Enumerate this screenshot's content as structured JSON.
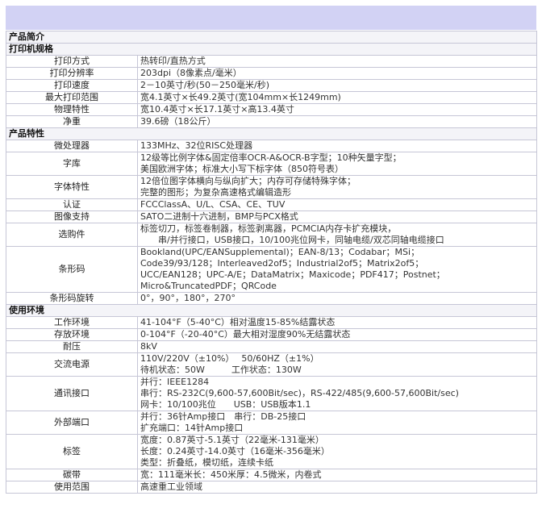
{
  "sections": [
    {
      "title": "产品简介",
      "rows": []
    },
    {
      "title": "打印机规格",
      "rows": [
        {
          "label": "打印方式",
          "lines": [
            "热转印/直热方式"
          ]
        },
        {
          "label": "打印分辨率",
          "lines": [
            "203dpi（8像素点/毫米）"
          ]
        },
        {
          "label": "打印速度",
          "lines": [
            "2－10英寸/秒(50－250毫米/秒)"
          ]
        },
        {
          "label": "最大打印范围",
          "lines": [
            "宽4.1英寸×长49.2英寸(宽104mm×长1249mm)"
          ]
        },
        {
          "label": "物理特性",
          "lines": [
            "宽10.4英寸×长17.1英寸×高13.4英寸"
          ]
        },
        {
          "label": "净重",
          "lines": [
            "39.6磅（18公斤）"
          ]
        }
      ]
    },
    {
      "title": "产品特性",
      "rows": [
        {
          "label": "微处理器",
          "lines": [
            "133MHz、32位RISC处理器"
          ]
        },
        {
          "label": "字库",
          "lines": [
            "12级等比例字体&固定倍率OCR-A&OCR-B字型；10种矢量字型；",
            "美国欧洲字体；标准大小写下标字体（850符号表）"
          ]
        },
        {
          "label": "字体特性",
          "lines": [
            "12倍位图字体横向与纵向扩大；内存可存储特殊字体；",
            "完整的图形；为复杂高速格式编辑造形"
          ]
        },
        {
          "label": "认证",
          "lines": [
            "FCCClassA、U/L、CSA、CE、TUV"
          ]
        },
        {
          "label": "图像支持",
          "lines": [
            "SATO二进制十六进制，BMP与PCX格式"
          ]
        },
        {
          "label": "选购件",
          "lines": [
            "标签切刀，标签卷制器，标签剥离器，PCMCIA内存卡扩充模块，",
            "　　串/并行接口，USB接口，10/100兆位网卡，同轴电缆/双芯同轴电缆接口"
          ]
        },
        {
          "label": "条形码",
          "lines": [
            "Bookland(UPC/EANSupplemental)；EAN-8/13；Codabar；MSi；",
            "Code39/93/128；Interleaved2of5；Industrial2of5；Matrix2of5；",
            "UCC/EAN128；UPC-A/E；DataMatrix；Maxicode；PDF417；Postnet；",
            "Micro&TruncatedPDF；QRCode"
          ]
        },
        {
          "label": "条形码旋转",
          "lines": [
            "0°，90°，180°，270°"
          ]
        }
      ]
    },
    {
      "title": "使用环境",
      "rows": [
        {
          "label": "工作环境",
          "lines": [
            "41-104°F（5-40°C）相对温度15-85%结露状态"
          ]
        },
        {
          "label": "存放环境",
          "lines": [
            "0-104°F（-20-40°C）最大相对湿度90%无结露状态"
          ]
        },
        {
          "label": "耐压",
          "lines": [
            "8kV"
          ]
        },
        {
          "label": "交流电源",
          "lines": [
            "110V/220V（±10%）　 50/60HZ（±1%）",
            "待机状态：50W　　　工作状态：130W"
          ]
        },
        {
          "label": "通讯接口",
          "lines": [
            "并行：IEEE1284",
            "串行：RS-232C(9,600-57,600Bit/sec)，RS-422/485(9,600-57,600Bit/sec)",
            "网卡：10/100兆位　　USB：USB版本1.1"
          ]
        },
        {
          "label": "外部端口",
          "lines": [
            "并行：36针Amp接口　串行：DB-25接口",
            "扩充端口：14针Amp接口"
          ]
        },
        {
          "label": "标签",
          "lines": [
            "宽度：0.87英寸-5.1英寸（22毫米-131毫米）",
            "长度：0.24英寸-14.0英寸（16毫米-356毫米）",
            "类型：折叠纸，模切纸，连续卡纸"
          ]
        },
        {
          "label": "碳带",
          "lines": [
            "宽：111毫米长：450米厚：4.5微米，内卷式"
          ]
        },
        {
          "label": "使用范围",
          "lines": [
            "高速重工业领域"
          ]
        }
      ]
    }
  ]
}
